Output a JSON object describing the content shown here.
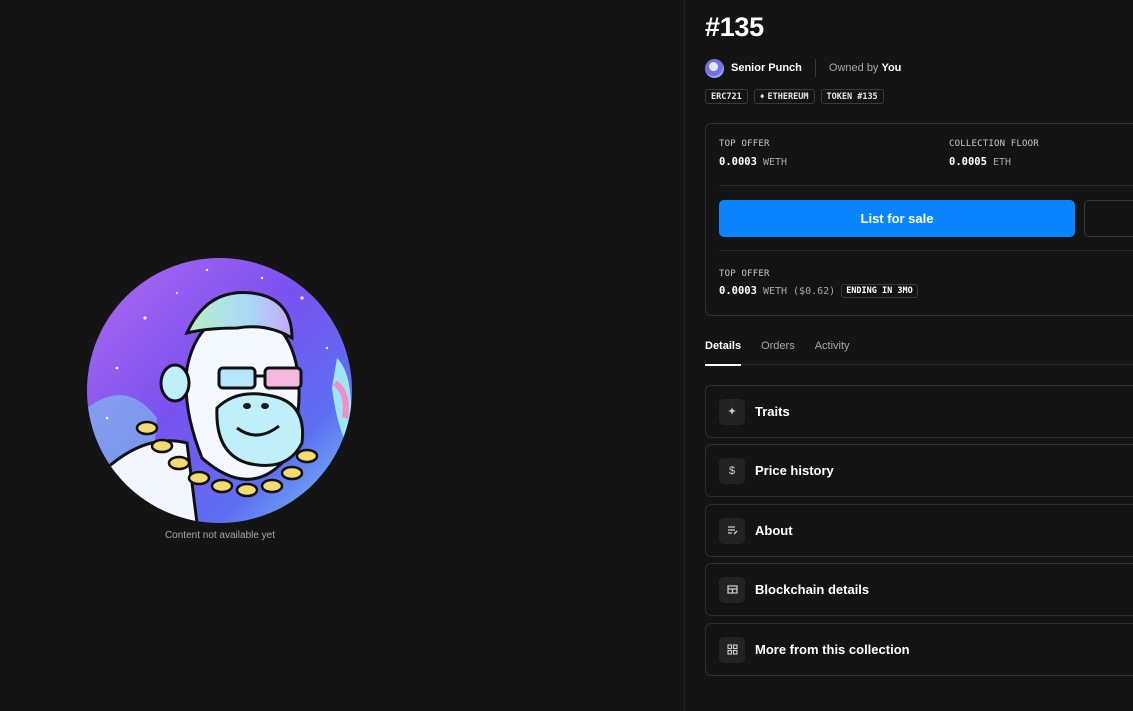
{
  "media": {
    "caption": "Content not available yet"
  },
  "item": {
    "title": "#135",
    "collection_name": "Senior Punch",
    "owned_by_label": "Owned by",
    "owner": "You"
  },
  "tags": [
    {
      "label": "ERC721",
      "icon": ""
    },
    {
      "label": "ETHEREUM",
      "icon": "ethereum-icon"
    },
    {
      "label": "TOKEN #135",
      "icon": ""
    }
  ],
  "offer_card": {
    "top_offer_label": "TOP OFFER",
    "top_offer_value": "0.0003",
    "top_offer_unit": "WETH",
    "floor_label": "COLLECTION FLOOR",
    "floor_value": "0.0005",
    "floor_unit": "ETH",
    "list_button": "List for sale",
    "bottom_label": "TOP OFFER",
    "bottom_value": "0.0003",
    "bottom_unit": "WETH",
    "bottom_usd": "($0.62)",
    "ending": "ENDING IN 3MO"
  },
  "tabs": [
    "Details",
    "Orders",
    "Activity"
  ],
  "active_tab": "Details",
  "sections": [
    {
      "label": "Traits",
      "icon": "sparkle-icon"
    },
    {
      "label": "Price history",
      "icon": "dollar-icon"
    },
    {
      "label": "About",
      "icon": "document-icon"
    },
    {
      "label": "Blockchain details",
      "icon": "chain-table-icon"
    },
    {
      "label": "More from this collection",
      "icon": "grid-icon"
    }
  ]
}
